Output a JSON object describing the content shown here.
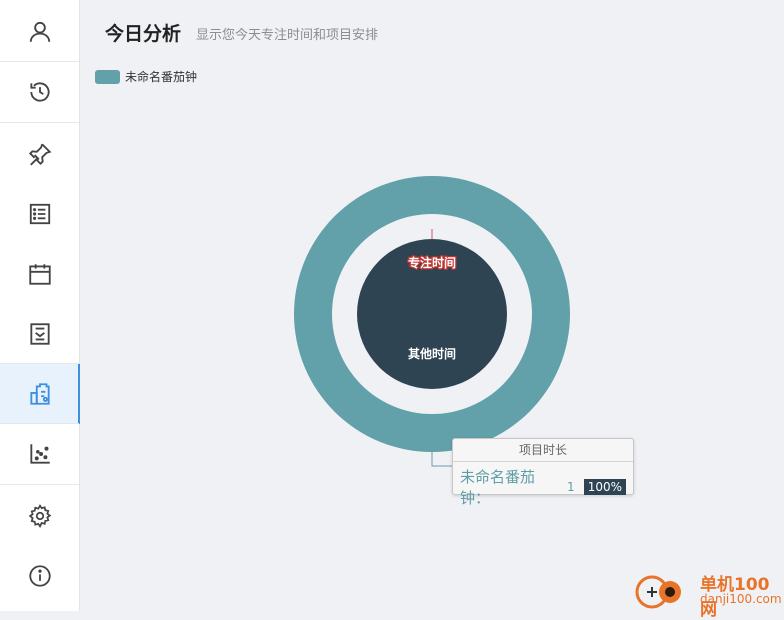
{
  "sidebar": {
    "items": [
      {
        "icon": "user-icon",
        "active": false
      },
      {
        "icon": "history-clock-icon",
        "active": false
      },
      {
        "icon": "pin-icon",
        "active": false
      },
      {
        "icon": "list-icon",
        "active": false
      },
      {
        "icon": "calendar-icon",
        "active": false
      },
      {
        "icon": "report-icon",
        "active": false
      },
      {
        "icon": "project-analysis-icon",
        "active": true
      },
      {
        "icon": "scatter-chart-icon",
        "active": false
      },
      {
        "icon": "settings-gear-icon",
        "active": false
      },
      {
        "icon": "info-icon",
        "active": false
      }
    ]
  },
  "header": {
    "title": "今日分析",
    "subtitle": "显示您今天专注时间和项目安排"
  },
  "colors": {
    "accent": "#3d8fe0",
    "outer_ring": "#62a0aa",
    "inner_pie": "#2e4453",
    "focus_label": "#c23531"
  },
  "chart_data": {
    "type": "pie",
    "outer": {
      "series_name": "项目时长",
      "slices": [
        {
          "name": "未命名番茄钟",
          "value": 1,
          "percent": 100
        }
      ]
    },
    "inner": {
      "slices": [
        {
          "name": "专注时间",
          "value": 0
        },
        {
          "name": "其他时间",
          "value": 1
        }
      ]
    },
    "legend": {
      "position": "top-left",
      "entries": [
        "未命名番茄钟"
      ]
    }
  },
  "tooltip": {
    "title": "项目时长",
    "name": "未命名番茄钟：",
    "value": "1",
    "percent": "100%"
  },
  "watermark": {
    "line1": "单机100网",
    "line2": "danji100.com"
  }
}
